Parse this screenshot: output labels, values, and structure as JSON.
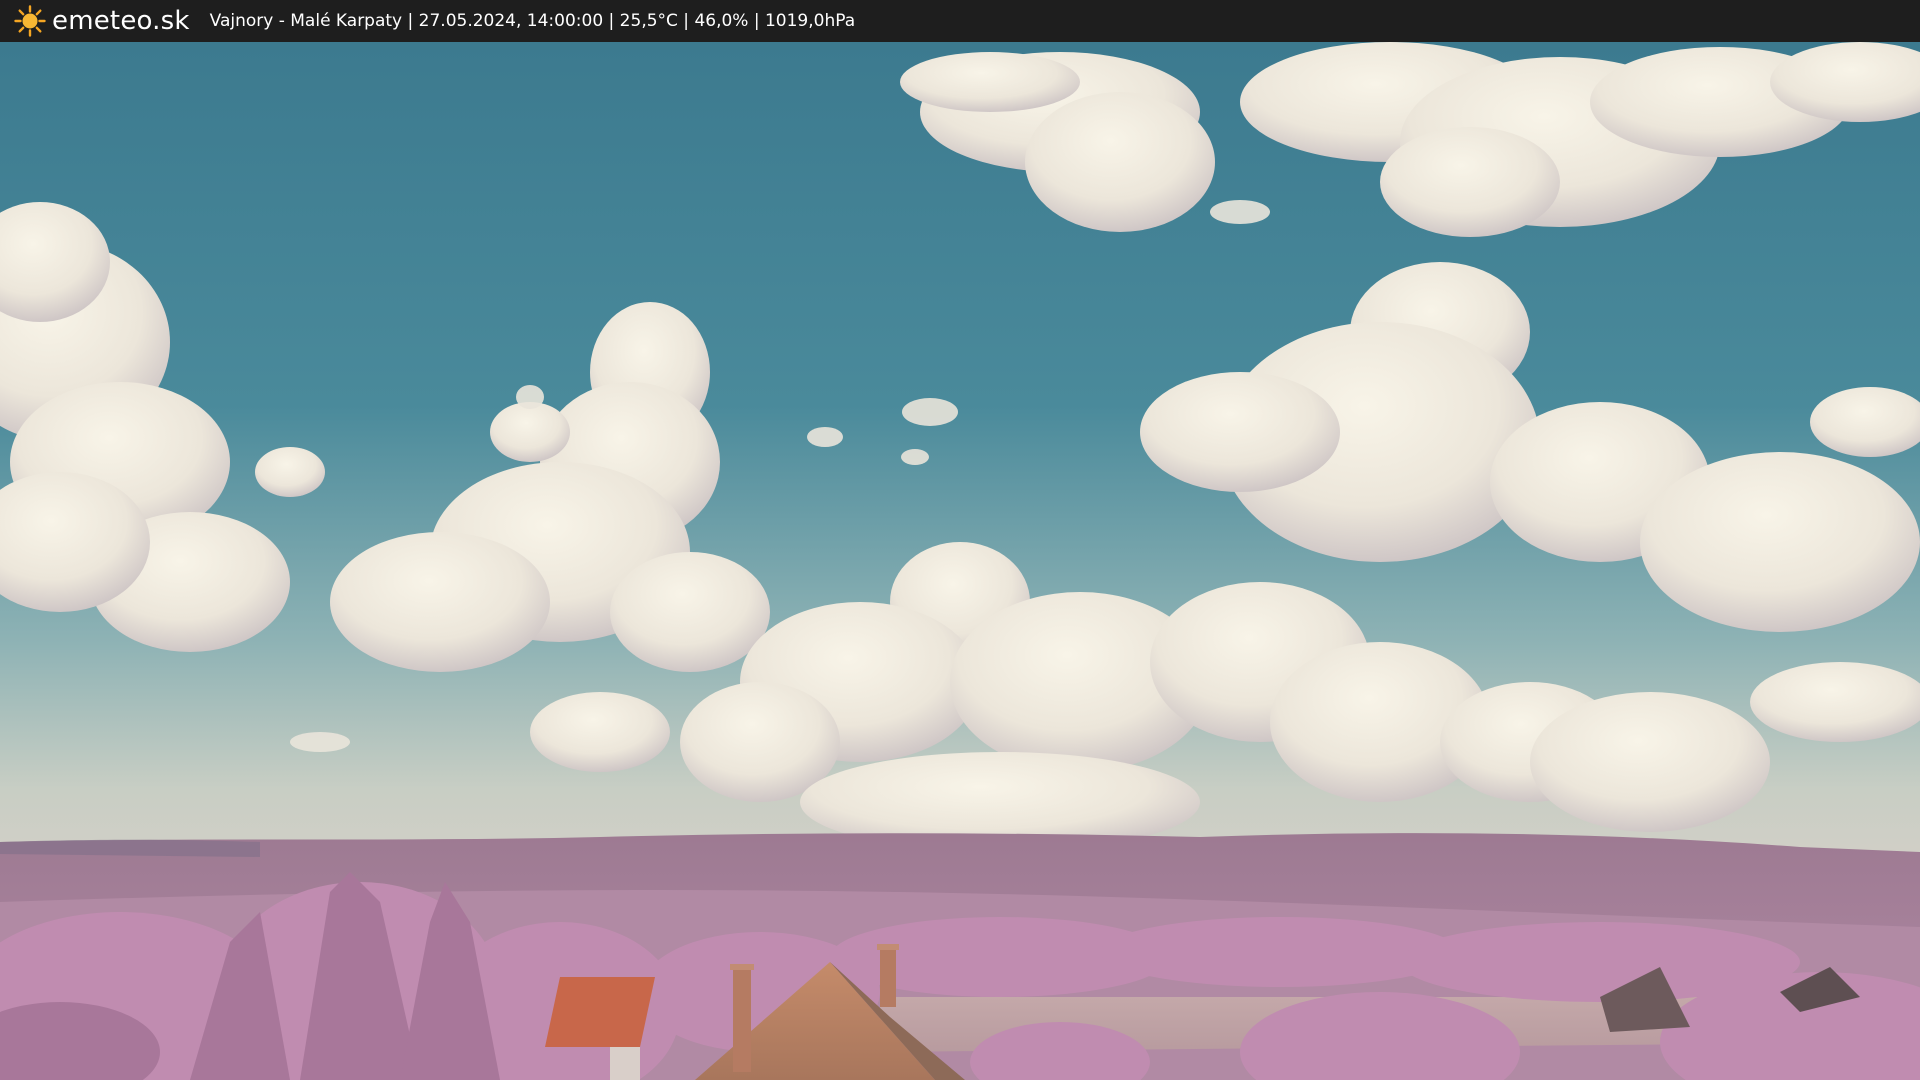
{
  "header": {
    "logo_icon": "sun-icon",
    "site_name": "emeteo.sk",
    "caption": "Vajnory - Malé Karpaty | 27.05.2024, 14:00:00 | 25,5°C | 46,0% | 1019,0hPa"
  },
  "colors": {
    "bar_background": "#1e1e1e",
    "sun": "#f5a623",
    "sky_top": "#3f7d92",
    "sky_horizon": "#cfd0c4",
    "cloud": "#f0ece0",
    "hills": "#a27c95",
    "trees": "#c690b5",
    "roof": "#c9694a"
  }
}
